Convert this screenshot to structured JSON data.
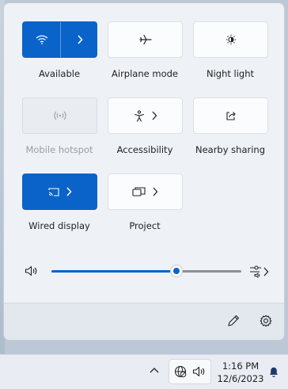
{
  "quick_settings": {
    "tiles": [
      {
        "id": "wifi",
        "label": "Available",
        "state": "on",
        "icon": "wifi-icon"
      },
      {
        "id": "airplane",
        "label": "Airplane mode",
        "state": "off",
        "icon": "airplane-icon"
      },
      {
        "id": "night",
        "label": "Night light",
        "state": "off",
        "icon": "brightness-icon"
      },
      {
        "id": "hotspot",
        "label": "Mobile hotspot",
        "state": "disabled",
        "icon": "hotspot-icon"
      },
      {
        "id": "accessibility",
        "label": "Accessibility",
        "state": "off",
        "icon": "accessibility-icon"
      },
      {
        "id": "nearby",
        "label": "Nearby sharing",
        "state": "off",
        "icon": "share-icon"
      },
      {
        "id": "wired",
        "label": "Wired display",
        "state": "on",
        "icon": "cast-icon"
      },
      {
        "id": "project",
        "label": "Project",
        "state": "off",
        "icon": "project-icon"
      }
    ]
  },
  "volume": {
    "level_percent": 66,
    "icon": "speaker-icon",
    "mixer_icon": "volume-mixer-icon"
  },
  "footer": {
    "edit_icon": "pencil-icon",
    "settings_icon": "gear-icon"
  },
  "taskbar": {
    "time": "1:16 PM",
    "date": "12/6/2023",
    "icons": [
      "chevron-up-icon",
      "network-icon",
      "speaker-icon",
      "bell-icon"
    ]
  },
  "colors": {
    "accent": "#0a63c9",
    "flyout_bg": "#eef1f6"
  }
}
